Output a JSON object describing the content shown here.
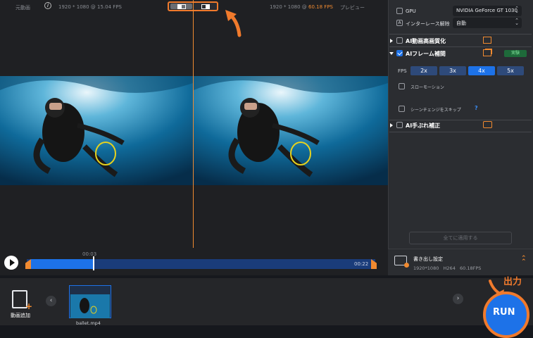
{
  "preview": {
    "original_label": "元動画",
    "info_icon": "info-icon",
    "original_info": "1920 * 1080 @ 15.04 FPS",
    "preview_info_prefix": "1920 * 1080 @ ",
    "preview_fps": "60.18 FPS",
    "preview_label": "プレビュー"
  },
  "timeline": {
    "marker_time": "00:03",
    "end_time": "00:22",
    "progress": 0.18
  },
  "settings": {
    "gpu_label": "GPU",
    "gpu_value": "NVIDIA GeForce GT 1030",
    "deinterlace_label": "インターレース解除",
    "deinterlace_value": "自動",
    "ai_upscale": "AI動画高画質化",
    "ai_frame": "AIフレーム補間",
    "trial_badge": "実験",
    "fps_label": "FPS",
    "fps_options": [
      "2x",
      "3x",
      "4x",
      "5x"
    ],
    "fps_selected": "4x",
    "slow_motion": "スローモーション",
    "skip_scene": "シーンチェンジをスキップ",
    "help": "?",
    "ai_stabilize": "AI手ぶれ補正",
    "apply_all": "全てに適用する"
  },
  "export": {
    "title": "書き出し設定",
    "details": "1920*1080   H264   60.18FPS"
  },
  "bottom": {
    "add_video": "動画追加",
    "file_name": "ballet.mp4",
    "output_label": "出力",
    "run_label": "RUN"
  },
  "colors": {
    "accent": "#1d72e8",
    "orange": "#f07a2c",
    "panel": "#2b2d31"
  }
}
